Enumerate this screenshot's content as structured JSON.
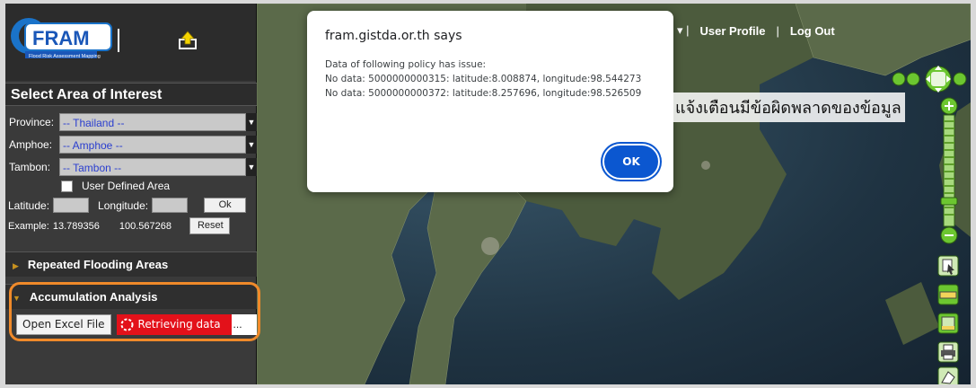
{
  "header": {
    "logo_text": "FRAM",
    "logo_subtitle": "Flood Risk Assessment Mapping",
    "nav": {
      "user_profile": "User Profile",
      "log_out": "Log Out"
    }
  },
  "sidebar": {
    "title": "Select Area of Interest",
    "province": {
      "label": "Province:",
      "value": "-- Thailand --"
    },
    "amphoe": {
      "label": "Amphoe:",
      "value": "-- Amphoe --"
    },
    "tambon": {
      "label": "Tambon:",
      "value": "-- Tambon --"
    },
    "user_defined_label": "User Defined Area",
    "latitude_label": "Latitude:",
    "longitude_label": "Longitude:",
    "ok_label": "Ok",
    "example_label": "Example:",
    "example_lat": "13.789356",
    "example_lon": "100.567268",
    "reset_label": "Reset",
    "sections": [
      {
        "label": "Repeated Flooding Areas"
      },
      {
        "label": "Accumulation Analysis"
      }
    ],
    "open_excel_label": "Open Excel File",
    "retrieving_label": "Retrieving data",
    "retrieving_dots": "..."
  },
  "dialog": {
    "title": "fram.gistda.or.th says",
    "lines": [
      "Data of following policy has issue:",
      "No data: 5000000000315: latitude:8.008874, longitude:98.544273",
      "No data: 5000000000372: latitude:8.257696, longitude:98.526509"
    ],
    "ok_label": "OK"
  },
  "annotation": "แจ้งเตือนมีข้อผิดพลาดของข้อมูล",
  "colors": {
    "accent_orange": "#f08a2a",
    "retrieving_red": "#e3111a",
    "dialog_button_blue": "#0b57d0",
    "select_text_blue": "#2a3ecf"
  }
}
